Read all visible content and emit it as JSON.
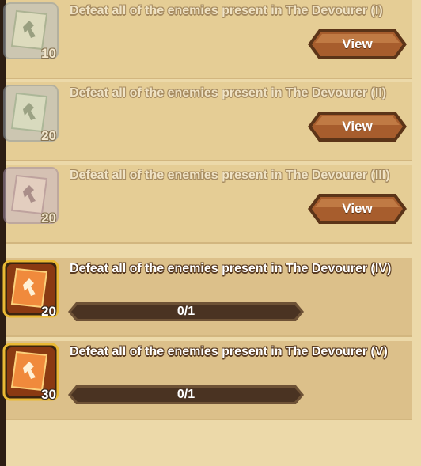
{
  "quests": [
    {
      "title": "Defeat all of the enemies present in The Devourer (I)",
      "reward_count": "10",
      "state": "complete",
      "button": "View"
    },
    {
      "title": "Defeat all of the enemies present in The Devourer (II)",
      "reward_count": "20",
      "state": "complete",
      "button": "View"
    },
    {
      "title": "Defeat all of the enemies present in The Devourer (III)",
      "reward_count": "20",
      "state": "complete",
      "button": "View"
    },
    {
      "title": "Defeat all of the enemies present in The Devourer (IV)",
      "reward_count": "20",
      "state": "in-progress",
      "progress_text": "0/1",
      "progress": 0
    },
    {
      "title": "Defeat all of the enemies present in The Devourer (V)",
      "reward_count": "30",
      "state": "in-progress",
      "progress_text": "0/1",
      "progress": 0
    }
  ],
  "colors": {
    "background": "#ecd9a9",
    "button": "#a0582a",
    "progress_track": "#4a3322"
  }
}
